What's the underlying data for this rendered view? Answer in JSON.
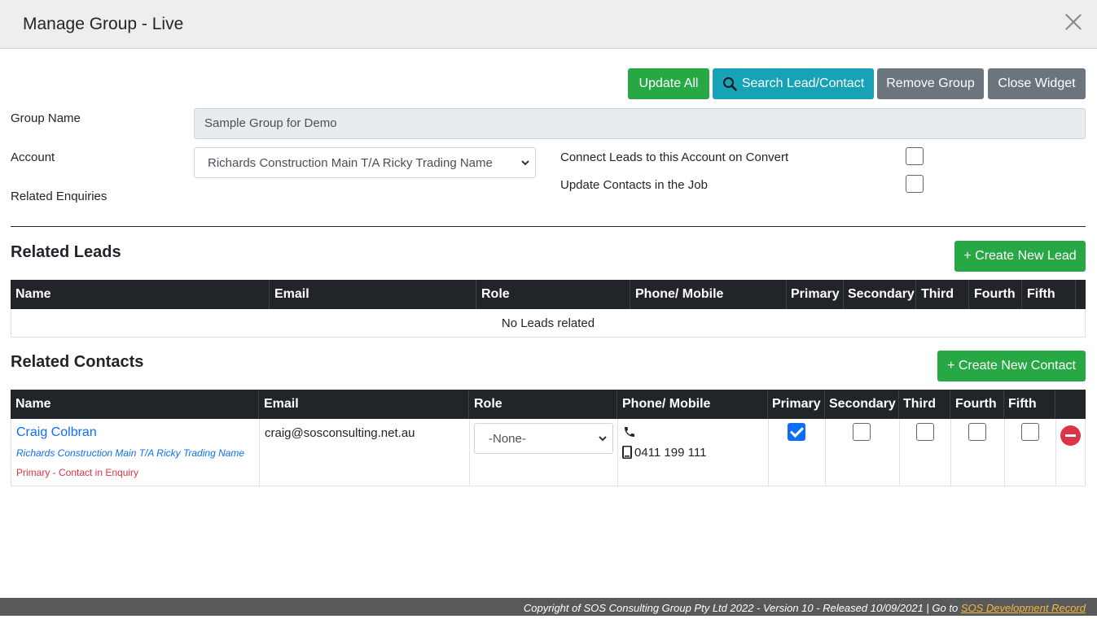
{
  "modal": {
    "title": "Manage Group - Live"
  },
  "toolbar": {
    "update_all": "Update All",
    "search": "Search Lead/Contact",
    "remove_group": "Remove Group",
    "close_widget": "Close Widget"
  },
  "form": {
    "group_name_label": "Group Name",
    "group_name_value": "Sample Group for Demo",
    "account_label": "Account",
    "account_value": "Richards Construction Main T/A Ricky Trading Name",
    "related_enquiries_label": "Related Enquiries",
    "connect_leads_label": "Connect Leads to this Account on Convert",
    "connect_leads_checked": false,
    "update_contacts_label": "Update Contacts in the Job",
    "update_contacts_checked": false
  },
  "leads": {
    "title": "Related Leads",
    "create_button": "+ Create New Lead",
    "headers": [
      "Name",
      "Email",
      "Role",
      "Phone/ Mobile",
      "Primary",
      "Secondary",
      "Third",
      "Fourth",
      "Fifth"
    ],
    "empty_message": "No Leads related"
  },
  "contacts": {
    "title": "Related Contacts",
    "create_button": "+ Create New Contact",
    "headers": [
      "Name",
      "Email",
      "Role",
      "Phone/ Mobile",
      "Primary",
      "Secondary",
      "Third",
      "Fourth",
      "Fifth"
    ],
    "rows": [
      {
        "name": "Craig Colbran",
        "account": "Richards Construction Main T/A Ricky Trading Name",
        "role_note": "Primary - Contact in Enquiry",
        "email": "craig@sosconsulting.net.au",
        "role": "-None-",
        "mobile": "0411 199 111",
        "primary": true,
        "secondary": false,
        "third": false,
        "fourth": false,
        "fifth": false
      }
    ]
  },
  "footer": {
    "text": "Copyright of SOS Consulting Group Pty Ltd 2022 - Version 10 - Released 10/09/2021 | Go to ",
    "link": "SOS Development Record"
  },
  "colors": {
    "success": "#28a745",
    "info": "#17a2b8",
    "secondary": "#6c757d",
    "table_header": "#212529",
    "link": "#0d6efd",
    "danger": "#dc3545",
    "footer_bg": "#58595b",
    "footer_link": "#f6b73c"
  },
  "icons": {
    "search": "search-icon",
    "phone": "phone-icon",
    "mobile": "mobile-icon",
    "remove": "remove-circle-icon",
    "close": "close-icon"
  }
}
